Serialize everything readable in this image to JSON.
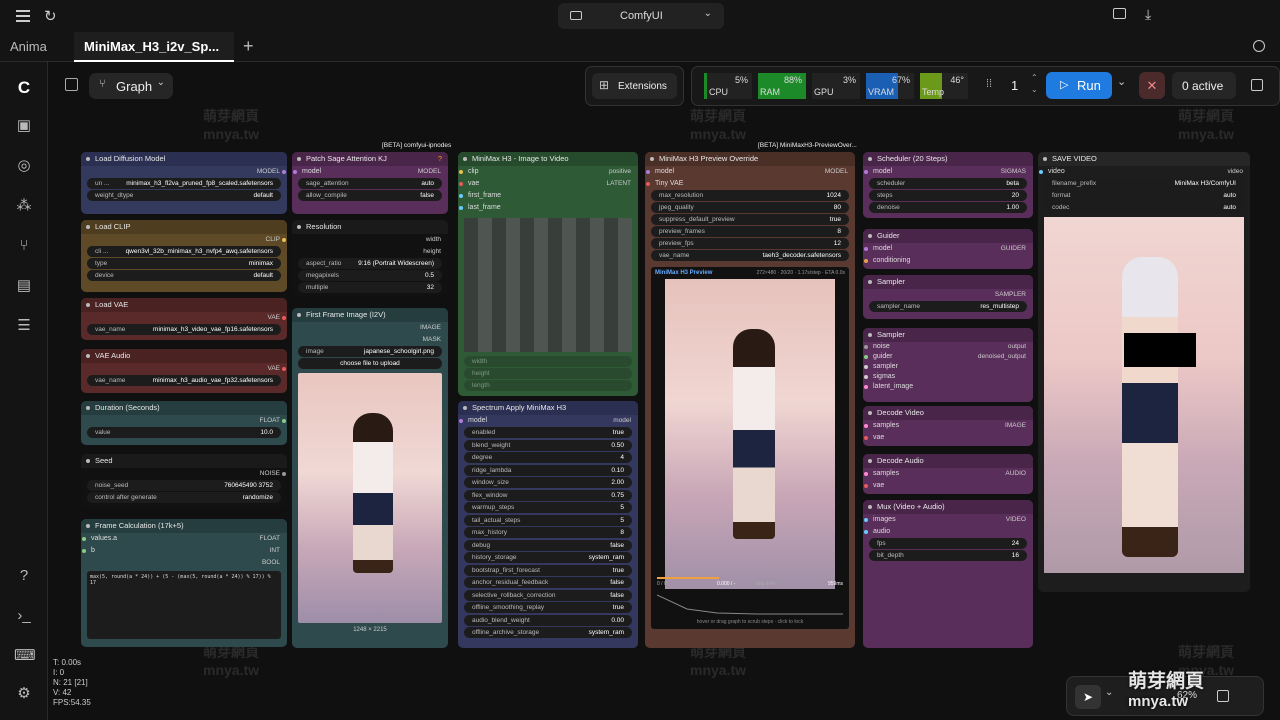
{
  "app": {
    "title": "ComfyUI"
  },
  "tabs": [
    {
      "label": "Anima"
    },
    {
      "label": "MiniMax_H3_i2v_Sp..."
    }
  ],
  "toolbar": {
    "graph": "Graph",
    "extensions": "Extensions",
    "run": "Run",
    "queue": "1",
    "active": "0 active"
  },
  "stats": {
    "cpu": {
      "label": "CPU",
      "value": "5%"
    },
    "ram": {
      "label": "RAM",
      "value": "88%"
    },
    "gpu": {
      "label": "GPU",
      "value": "3%"
    },
    "vram": {
      "label": "VRAM",
      "value": "67%"
    },
    "temp": {
      "label": "Temp",
      "value": "46°"
    }
  },
  "groups": {
    "g1": "[BETA] comfyui-ipnodes",
    "g2": "[BETA] MiniMaxH3-PreviewOver..."
  },
  "nodes": {
    "load_diffusion": {
      "title": "Load Diffusion Model",
      "out": "MODEL",
      "w1k": "un ...",
      "w1v": "minimax_h3_fl2va_pruned_fp8_scaled.safetensors",
      "w2k": "weight_dtype",
      "w2v": "default"
    },
    "load_clip": {
      "title": "Load CLIP",
      "out": "CLIP",
      "w1k": "cli ...",
      "w1v": "qwen3vl_32b_minimax_h3_nvfp4_awq.safetensors",
      "w2k": "type",
      "w2v": "minimax",
      "w3k": "device",
      "w3v": "default"
    },
    "load_vae": {
      "title": "Load VAE",
      "out": "VAE",
      "w1k": "vae_name",
      "w1v": "minimax_h3_video_vae_fp16.safetensors"
    },
    "vae_audio": {
      "title": "VAE Audio",
      "out": "VAE",
      "w1k": "vae_name",
      "w1v": "minimax_h3_audio_vae_fp32.safetensors"
    },
    "duration": {
      "title": "Duration (Seconds)",
      "out": "FLOAT",
      "w1k": "value",
      "w1v": "10.0"
    },
    "seed": {
      "title": "Seed",
      "out": "NOISE",
      "w1k": "noise_seed",
      "w1v": "760645490 3752",
      "w2k": "control after generate",
      "w2v": "randomize"
    },
    "frame_calc": {
      "title": "Frame Calculation (17k+5)",
      "in1": "values.a",
      "in2": "b",
      "out1": "FLOAT",
      "out2": "INT",
      "out3": "BOOL",
      "expr": "max(5, round(a * 24)) + (5 - (max(5, round(a * 24)) % 17)) % 17"
    },
    "patch_sage": {
      "title": "Patch Sage Attention KJ",
      "badge": "?",
      "in": "model",
      "out": "MODEL",
      "w1k": "sage_attention",
      "w1v": "auto",
      "w2k": "allow_compile",
      "w2v": "false"
    },
    "resolution": {
      "title": "Resolution",
      "o1": "width",
      "o2": "height",
      "w1k": "aspect_ratio",
      "w1v": "9:16 (Portrait Widescreen)",
      "w2k": "megapixels",
      "w2v": "0.5",
      "w3k": "multiple",
      "w3v": "32"
    },
    "first_frame": {
      "title": "First Frame Image (I2V)",
      "o1": "IMAGE",
      "o2": "MASK",
      "w1k": "image",
      "w1v": "japanese_schoolgirl.png",
      "btn": "choose file to upload",
      "size": "1248 × 2215"
    },
    "i2v": {
      "title": "MiniMax H3 - Image to Video",
      "i1": "clip",
      "i2": "vae",
      "i3": "first_frame",
      "i4": "last_frame",
      "o1": "positive",
      "o2": "LATENT",
      "f1": "width",
      "f2": "height",
      "f3": "length"
    },
    "spectrum": {
      "title": "Spectrum Apply MiniMax H3",
      "in": "model",
      "out": "model",
      "rows": [
        {
          "k": "enabled",
          "v": "true"
        },
        {
          "k": "blend_weight",
          "v": "0.50"
        },
        {
          "k": "degree",
          "v": "4"
        },
        {
          "k": "ridge_lambda",
          "v": "0.10"
        },
        {
          "k": "window_size",
          "v": "2.00"
        },
        {
          "k": "flex_window",
          "v": "0.75"
        },
        {
          "k": "warmup_steps",
          "v": "5"
        },
        {
          "k": "tail_actual_steps",
          "v": "5"
        },
        {
          "k": "max_history",
          "v": "8"
        },
        {
          "k": "debug",
          "v": "false"
        },
        {
          "k": "history_storage",
          "v": "system_ram"
        },
        {
          "k": "bootstrap_first_forecast",
          "v": "true"
        },
        {
          "k": "anchor_residual_feedback",
          "v": "false"
        },
        {
          "k": "selective_rollback_correction",
          "v": "false"
        },
        {
          "k": "offline_smoothing_replay",
          "v": "true"
        },
        {
          "k": "audio_blend_weight",
          "v": "0.00"
        },
        {
          "k": "offline_archive_storage",
          "v": "system_ram"
        }
      ]
    },
    "preview_override": {
      "title": "MiniMax H3 Preview Override",
      "i1": "model",
      "i2": "Tiny VAE",
      "o1": "MODEL",
      "rows": [
        {
          "k": "max_resolution",
          "v": "1024"
        },
        {
          "k": "jpeg_quality",
          "v": "80"
        },
        {
          "k": "suppress_default_preview",
          "v": "true"
        },
        {
          "k": "preview_frames",
          "v": "8"
        },
        {
          "k": "preview_fps",
          "v": "12"
        },
        {
          "k": "vae_name",
          "v": "taeh3_decoder.safetensors"
        }
      ],
      "ptitle": "MiniMax H3 Preview",
      "pinfo": "272×480 · 20/20 · 1.17s/step · ETA 0.0s",
      "t1": "0 / 0",
      "t2": "0.000 / -",
      "t3": "step time",
      "t4": "959ms",
      "hint": "hover or drag graph to scrub steps · click to lock"
    },
    "scheduler": {
      "title": "Scheduler (20 Steps)",
      "in": "model",
      "out": "SIGMAS",
      "w1k": "scheduler",
      "w1v": "beta",
      "w2k": "steps",
      "w2v": "20",
      "w3k": "denoise",
      "w3v": "1.00"
    },
    "guider": {
      "title": "Guider",
      "i1": "model",
      "i2": "conditioning",
      "out": "GUIDER"
    },
    "sampler1": {
      "title": "Sampler",
      "out": "SAMPLER",
      "w1k": "sampler_name",
      "w1v": "res_multistep"
    },
    "sampler2": {
      "title": "Sampler",
      "i1": "noise",
      "i2": "guider",
      "i3": "sampler",
      "i4": "sigmas",
      "i5": "latent_image",
      "o1": "output",
      "o2": "denoised_output"
    },
    "decode_video": {
      "title": "Decode Video",
      "i1": "samples",
      "i2": "vae",
      "out": "IMAGE"
    },
    "decode_audio": {
      "title": "Decode Audio",
      "i1": "samples",
      "i2": "vae",
      "out": "AUDIO"
    },
    "mux": {
      "title": "Mux (Video + Audio)",
      "i1": "images",
      "i2": "audio",
      "out": "VIDEO",
      "w1k": "fps",
      "w1v": "24",
      "w2k": "bit_depth",
      "w2v": "16"
    },
    "save": {
      "title": "SAVE VIDEO",
      "in": "video",
      "out": "video",
      "w1k": "filename_prefix",
      "w1v": "MiniMax H3/ComfyUI",
      "w2k": "format",
      "w2v": "auto",
      "w3k": "codec",
      "w3v": "auto"
    }
  },
  "stats_overlay": [
    "T: 0.00s",
    "I: 0",
    "N: 21 [21]",
    "V: 42",
    "FPS:54.35"
  ],
  "zoom": "62%",
  "watermark": {
    "cn": "萌芽網頁",
    "en": "mnya.tw"
  },
  "colors": {
    "run": "#1f7be0",
    "cpu": "#1d6b2a",
    "ram": "#1d8a2a",
    "gpu": "#2a2a2a",
    "vram": "#1a5fb4",
    "temp": "#6b9a1a"
  }
}
